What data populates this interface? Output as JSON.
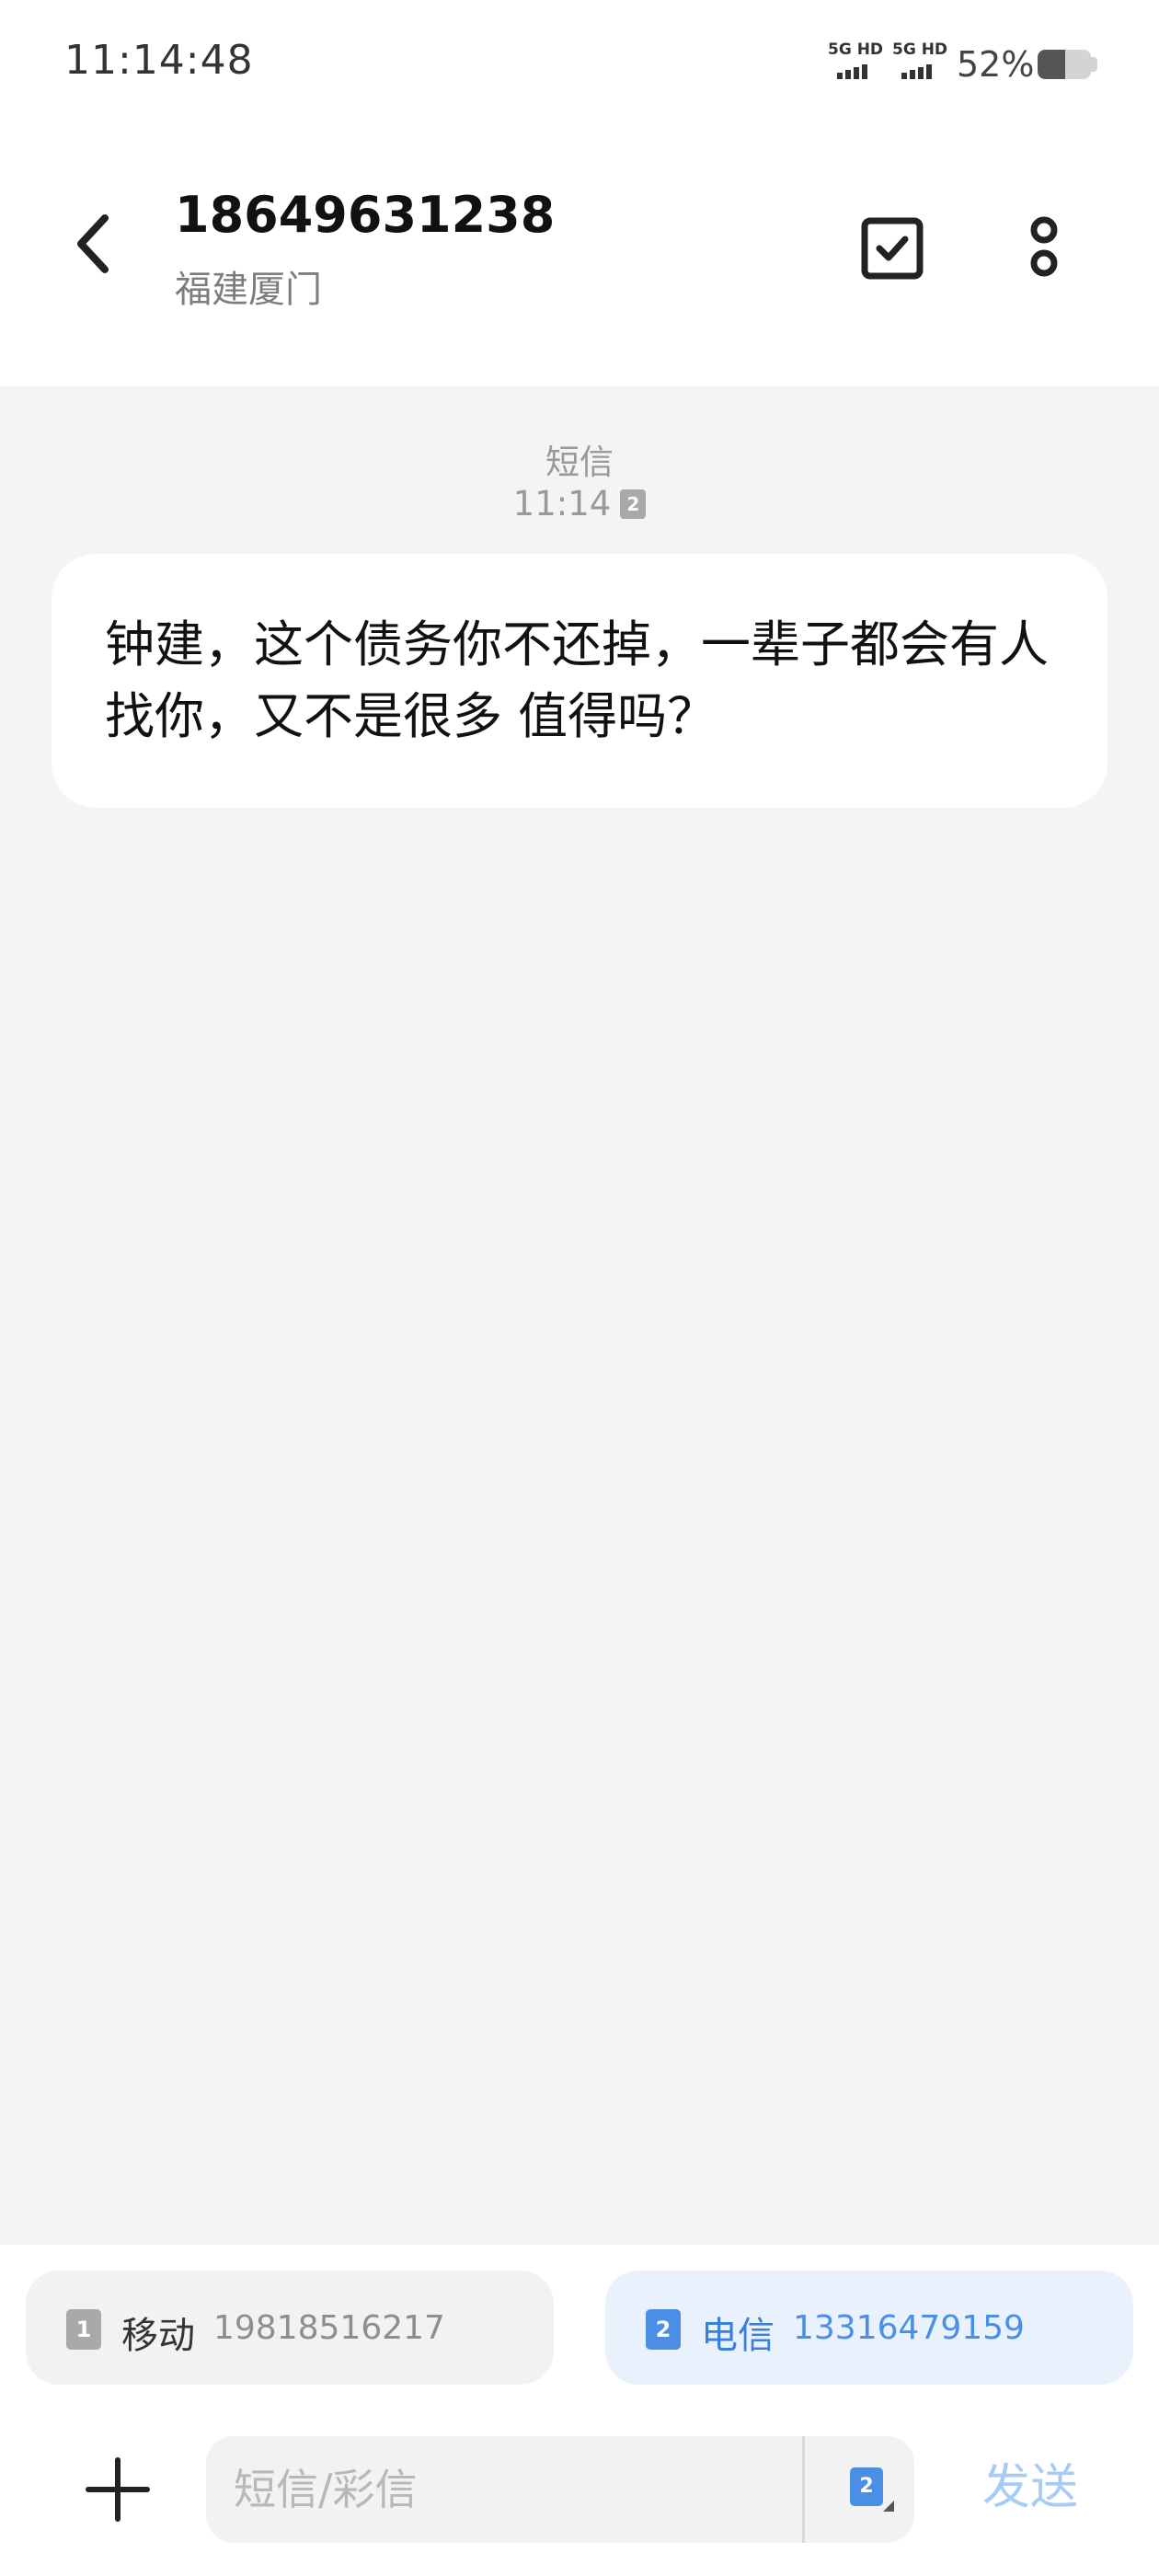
{
  "status_bar": {
    "time": "11:14:48",
    "signal_1_label": "5G HD",
    "signal_2_label": "5G HD",
    "battery_percent": "52%",
    "battery_level": 0.52
  },
  "header": {
    "contact_number": "18649631238",
    "contact_location": "福建厦门",
    "back_icon": "chevron-left-icon",
    "select_icon": "checkbox-icon",
    "more_icon": "more-vertical-icon"
  },
  "conversation": {
    "message_type": "短信",
    "message_time": "11:14",
    "sim_badge": "2",
    "message_text": "钟建，这个债务你不还掉，一辈子都会有人找你，又不是很多 值得吗？"
  },
  "sim_options": [
    {
      "slot": "1",
      "carrier": "移动",
      "number": "19818516217",
      "selected": false
    },
    {
      "slot": "2",
      "carrier": "电信",
      "number": "13316479159",
      "selected": true
    }
  ],
  "composer": {
    "add_icon": "plus-icon",
    "placeholder": "短信/彩信",
    "value": "",
    "selected_sim": "2",
    "send_label": "发送"
  },
  "colors": {
    "accent": "#4a8ee6",
    "send_disabled": "#a6cbf5",
    "conversation_bg": "#f4f4f4"
  }
}
